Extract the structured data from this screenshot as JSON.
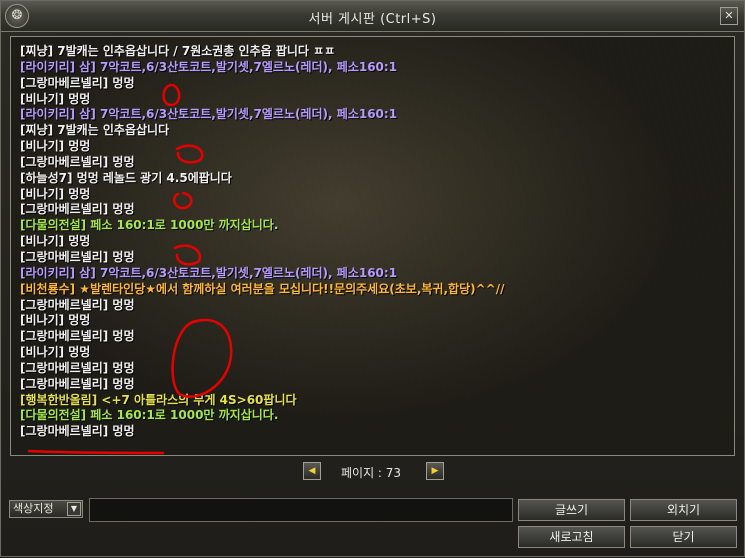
{
  "window": {
    "title": "서버 게시판 (Ctrl+S)",
    "close_glyph": "✕",
    "app_glyph": "❂"
  },
  "chat": [
    {
      "text": "[찌냥] 7발캐는 인추옵삽니다  / 7원소권총 인추옵 팝니다 ㅍㅍ",
      "color": "#f0f0f0"
    },
    {
      "text": "[라이키리] 삼] 7악코트,6/3산토코트,발기셋,7엘르노(레더), 페소160:1",
      "color": "#b79bff"
    },
    {
      "text": "[그랑마베르넬리] 멍멍",
      "color": "#f0f0f0"
    },
    {
      "text": "[비나기] 멍멍",
      "color": "#f0f0f0"
    },
    {
      "text": "[라이키리] 삼] 7악코트,6/3산토코트,발기셋,7엘르노(레더), 페소160:1",
      "color": "#b79bff"
    },
    {
      "text": "[찌냥] 7발캐는 인추옵삽니다",
      "color": "#f0f0f0"
    },
    {
      "text": "[비나기] 멍멍",
      "color": "#f0f0f0"
    },
    {
      "text": "[그랑마베르넬리] 멍멍",
      "color": "#f0f0f0"
    },
    {
      "text": "[하늘성7] 멍멍 레놀드 광기 4.5에팝니다",
      "color": "#f0f0f0"
    },
    {
      "text": "[비나기] 멍멍",
      "color": "#f0f0f0"
    },
    {
      "text": "[그랑마베르넬리] 멍멍",
      "color": "#f0f0f0"
    },
    {
      "text": "[다물의전설] 페소 160:1로 1000만 까지삽니다.",
      "color": "#a4e64f"
    },
    {
      "text": "[비나기] 멍멍",
      "color": "#f0f0f0"
    },
    {
      "text": "[그랑마베르넬리] 멍멍",
      "color": "#f0f0f0"
    },
    {
      "text": "[라이키리] 삼] 7악코트,6/3산토코트,발기셋,7엘르노(레더), 페소160:1",
      "color": "#b79bff"
    },
    {
      "text": "[비천룡수] ★발렌타인당★에서 함께하실 여러분을 모십니다!!문의주세요(초보,복귀,합당)^^//",
      "color": "#ffb73a"
    },
    {
      "text": "[그랑마베르넬리] 멍멍",
      "color": "#f0f0f0"
    },
    {
      "text": "[비나기] 멍멍",
      "color": "#f0f0f0"
    },
    {
      "text": "[그랑마베르넬리] 멍멍",
      "color": "#f0f0f0"
    },
    {
      "text": "[비나기] 멍멍",
      "color": "#f0f0f0"
    },
    {
      "text": "[그랑마베르넬리] 멍멍",
      "color": "#f0f0f0"
    },
    {
      "text": "[그랑마베르넬리] 멍멍",
      "color": "#f0f0f0"
    },
    {
      "text": "[행복한반올림] <+7 아틀라스의 무게 4S>60팝니다",
      "color": "#e6e24f"
    },
    {
      "text": "[다물의전설] 페소 160:1로 1000만 까지삽니다.",
      "color": "#a4e64f"
    },
    {
      "text": "[그랑마베르넬리] 멍멍",
      "color": "#f0f0f0"
    }
  ],
  "pager": {
    "label": "페이지 : 73",
    "prev_glyph": "◀",
    "next_glyph": "▶"
  },
  "controls": {
    "color_select": "색상지정",
    "dropdown_glyph": "▼",
    "message_value": "",
    "write": "글쓰기",
    "whisper": "외치기",
    "refresh": "새로고침",
    "close": "닫기"
  },
  "colors": {
    "white": "#f0f0f0",
    "purple": "#b79bff",
    "green": "#a4e64f",
    "orange": "#ffb73a",
    "gold": "#e6e24f",
    "annotation_red": "#e60000"
  }
}
